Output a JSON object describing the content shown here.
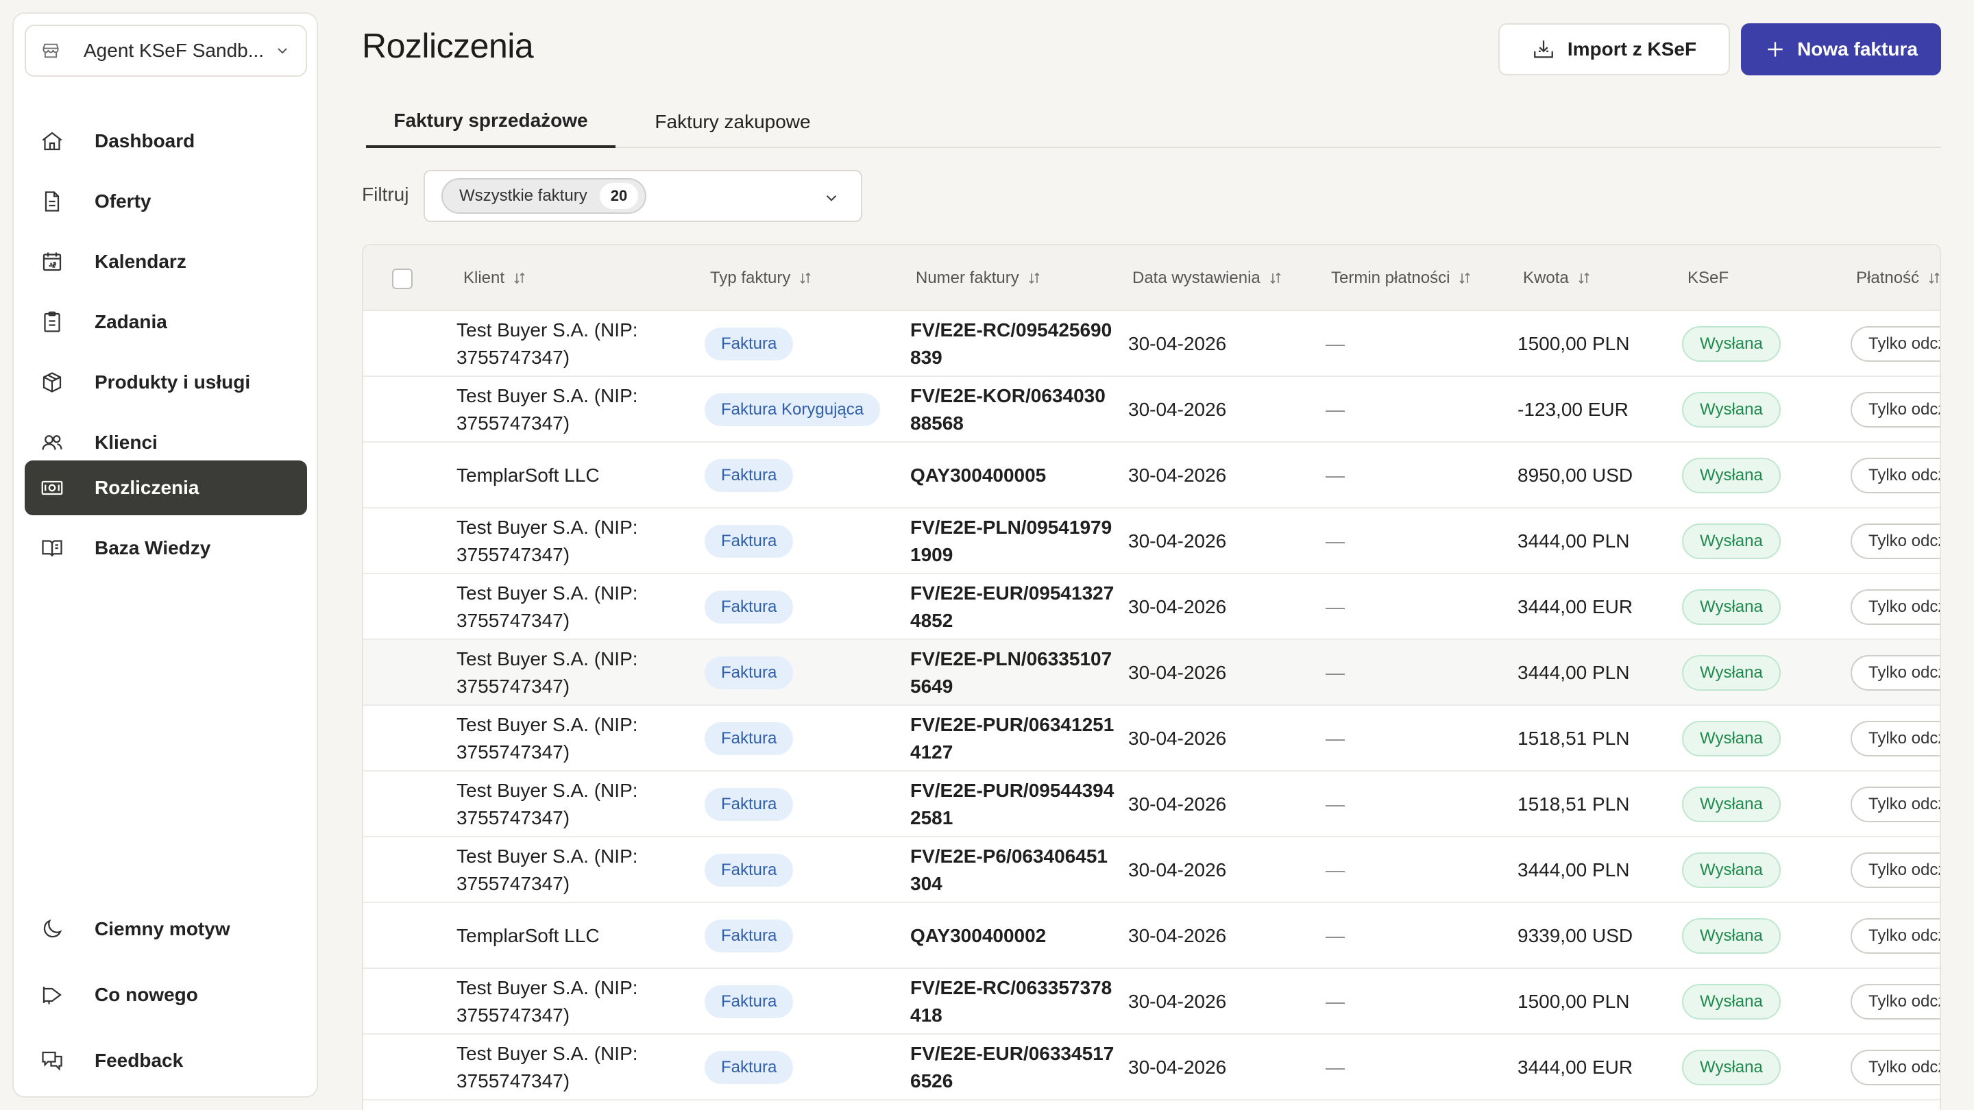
{
  "workspace": {
    "name": "Agent KSeF Sandb..."
  },
  "sidebar": {
    "items": [
      {
        "label": "Dashboard",
        "icon": "home-icon"
      },
      {
        "label": "Oferty",
        "icon": "document-icon"
      },
      {
        "label": "Kalendarz",
        "icon": "calendar-icon"
      },
      {
        "label": "Zadania",
        "icon": "clipboard-icon"
      },
      {
        "label": "Produkty i usługi",
        "icon": "box-icon"
      },
      {
        "label": "Klienci",
        "icon": "users-icon"
      },
      {
        "label": "Rozliczenia",
        "icon": "banknote-icon",
        "active": true
      },
      {
        "label": "Baza Wiedzy",
        "icon": "book-icon"
      }
    ],
    "bottom": [
      {
        "label": "Ciemny motyw",
        "icon": "moon-icon"
      },
      {
        "label": "Co nowego",
        "icon": "megaphone-icon"
      },
      {
        "label": "Feedback",
        "icon": "chat-icon"
      }
    ]
  },
  "header": {
    "title": "Rozliczenia",
    "import_label": "Import z KSeF",
    "new_label": "Nowa faktura"
  },
  "tabs": [
    {
      "label": "Faktury sprzedażowe",
      "active": true
    },
    {
      "label": "Faktury zakupowe",
      "active": false
    }
  ],
  "filter": {
    "label": "Filtruj",
    "chip_label": "Wszystkie faktury",
    "chip_count": "20"
  },
  "table": {
    "columns": [
      "Klient",
      "Typ faktury",
      "Numer faktury",
      "Data wystawienia",
      "Termin płatności",
      "Kwota",
      "KSeF",
      "Płatność"
    ],
    "rows": [
      {
        "client": "Test Buyer S.A. (NIP: 3755747347)",
        "type": "Faktura",
        "number": "FV/E2E-RC/095425690839",
        "date": "30-04-2026",
        "due": "—",
        "amount": "1500,00 PLN",
        "ksef": "Wysłana",
        "payment": "Tylko odczyt"
      },
      {
        "client": "Test Buyer S.A. (NIP: 3755747347)",
        "type": "Faktura Korygująca",
        "number": "FV/E2E-KOR/063403088568",
        "date": "30-04-2026",
        "due": "—",
        "amount": "-123,00 EUR",
        "ksef": "Wysłana",
        "payment": "Tylko odczyt"
      },
      {
        "client": "TemplarSoft LLC",
        "type": "Faktura",
        "number": "QAY300400005",
        "date": "30-04-2026",
        "due": "—",
        "amount": "8950,00 USD",
        "ksef": "Wysłana",
        "payment": "Tylko odczyt"
      },
      {
        "client": "Test Buyer S.A. (NIP: 3755747347)",
        "type": "Faktura",
        "number": "FV/E2E-PLN/095419791909",
        "date": "30-04-2026",
        "due": "—",
        "amount": "3444,00 PLN",
        "ksef": "Wysłana",
        "payment": "Tylko odczyt"
      },
      {
        "client": "Test Buyer S.A. (NIP: 3755747347)",
        "type": "Faktura",
        "number": "FV/E2E-EUR/095413274852",
        "date": "30-04-2026",
        "due": "—",
        "amount": "3444,00 EUR",
        "ksef": "Wysłana",
        "payment": "Tylko odczyt"
      },
      {
        "client": "Test Buyer S.A. (NIP: 3755747347)",
        "type": "Faktura",
        "number": "FV/E2E-PLN/063351075649",
        "date": "30-04-2026",
        "due": "—",
        "amount": "3444,00 PLN",
        "ksef": "Wysłana",
        "payment": "Tylko odczyt"
      },
      {
        "client": "Test Buyer S.A. (NIP: 3755747347)",
        "type": "Faktura",
        "number": "FV/E2E-PUR/063412514127",
        "date": "30-04-2026",
        "due": "—",
        "amount": "1518,51 PLN",
        "ksef": "Wysłana",
        "payment": "Tylko odczyt"
      },
      {
        "client": "Test Buyer S.A. (NIP: 3755747347)",
        "type": "Faktura",
        "number": "FV/E2E-PUR/095443942581",
        "date": "30-04-2026",
        "due": "—",
        "amount": "1518,51 PLN",
        "ksef": "Wysłana",
        "payment": "Tylko odczyt"
      },
      {
        "client": "Test Buyer S.A. (NIP: 3755747347)",
        "type": "Faktura",
        "number": "FV/E2E-P6/063406451304",
        "date": "30-04-2026",
        "due": "—",
        "amount": "3444,00 PLN",
        "ksef": "Wysłana",
        "payment": "Tylko odczyt"
      },
      {
        "client": "TemplarSoft LLC",
        "type": "Faktura",
        "number": "QAY300400002",
        "date": "30-04-2026",
        "due": "—",
        "amount": "9339,00 USD",
        "ksef": "Wysłana",
        "payment": "Tylko odczyt"
      },
      {
        "client": "Test Buyer S.A. (NIP: 3755747347)",
        "type": "Faktura",
        "number": "FV/E2E-RC/063357378418",
        "date": "30-04-2026",
        "due": "—",
        "amount": "1500,00 PLN",
        "ksef": "Wysłana",
        "payment": "Tylko odczyt"
      },
      {
        "client": "Test Buyer S.A. (NIP: 3755747347)",
        "type": "Faktura",
        "number": "FV/E2E-EUR/063345176526",
        "date": "30-04-2026",
        "due": "—",
        "amount": "3444,00 EUR",
        "ksef": "Wysłana",
        "payment": "Tylko odczyt"
      }
    ]
  },
  "colors": {
    "primary": "#3c3fa8",
    "active_nav": "#3b3b37",
    "badge_type_bg": "#e5effc",
    "badge_ksef_bg": "#e9f7ef",
    "badge_ksef_text": "#1f8a4c"
  }
}
